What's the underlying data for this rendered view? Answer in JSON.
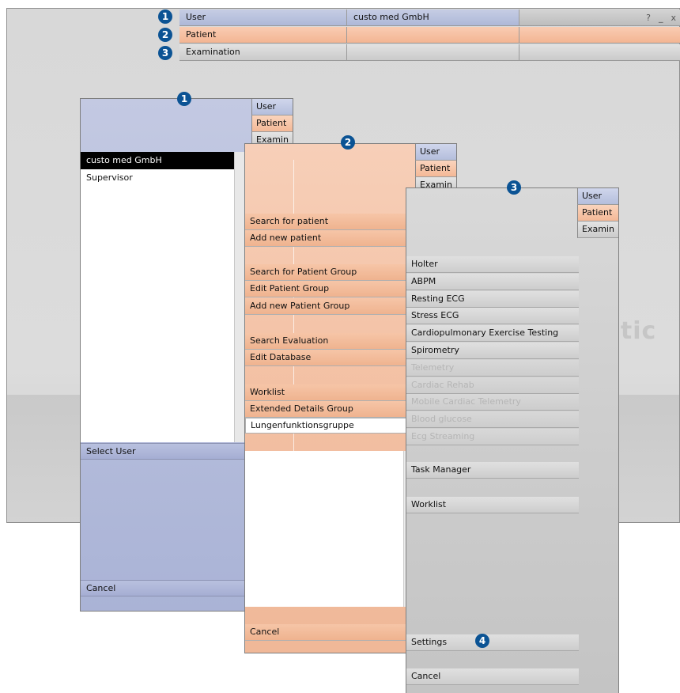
{
  "main_window": {
    "user_label": "User",
    "user_value": "custo med GmbH",
    "help_button": "?",
    "minimize_button": "_",
    "close_button": "x",
    "patient_label": "Patient",
    "examination_label": "Examination",
    "watermark_text": "stic"
  },
  "badges": [
    "1",
    "2",
    "3",
    "4"
  ],
  "tabs": {
    "user": "User",
    "patient": "Patient",
    "examination": "Examin"
  },
  "user_panel": {
    "users": [
      "custo med GmbH",
      "Supervisor"
    ],
    "select_user_button": "Select User",
    "cancel_button": "Cancel"
  },
  "patient_panel": {
    "items": [
      "Search for patient",
      "Add new patient",
      "Search for Patient Group",
      "Edit Patient Group",
      "Add new Patient Group",
      "Search Evaluation",
      "Edit Database",
      "Worklist",
      "Extended Details Group"
    ],
    "group_select_value": "Lungenfunktionsgruppe",
    "cancel_button": "Cancel"
  },
  "examination_panel": {
    "items": [
      {
        "label": "Holter",
        "enabled": true
      },
      {
        "label": "ABPM",
        "enabled": true
      },
      {
        "label": "Resting ECG",
        "enabled": true
      },
      {
        "label": "Stress ECG",
        "enabled": true
      },
      {
        "label": "Cardiopulmonary Exercise Testing",
        "enabled": true
      },
      {
        "label": "Spirometry",
        "enabled": true
      },
      {
        "label": "Telemetry",
        "enabled": false
      },
      {
        "label": "Cardiac Rehab",
        "enabled": false
      },
      {
        "label": "Mobile Cardiac Telemetry",
        "enabled": false
      },
      {
        "label": "Blood glucose",
        "enabled": false
      },
      {
        "label": "Ecg Streaming",
        "enabled": false
      }
    ],
    "task_manager_button": "Task Manager",
    "worklist_button": "Worklist",
    "settings_button": "Settings",
    "cancel_button": "Cancel"
  },
  "colors": {
    "badge": "#0b5394",
    "user_accent": "#b4bcdb",
    "patient_accent": "#f3b593",
    "examination_accent": "#cdcdcd"
  }
}
